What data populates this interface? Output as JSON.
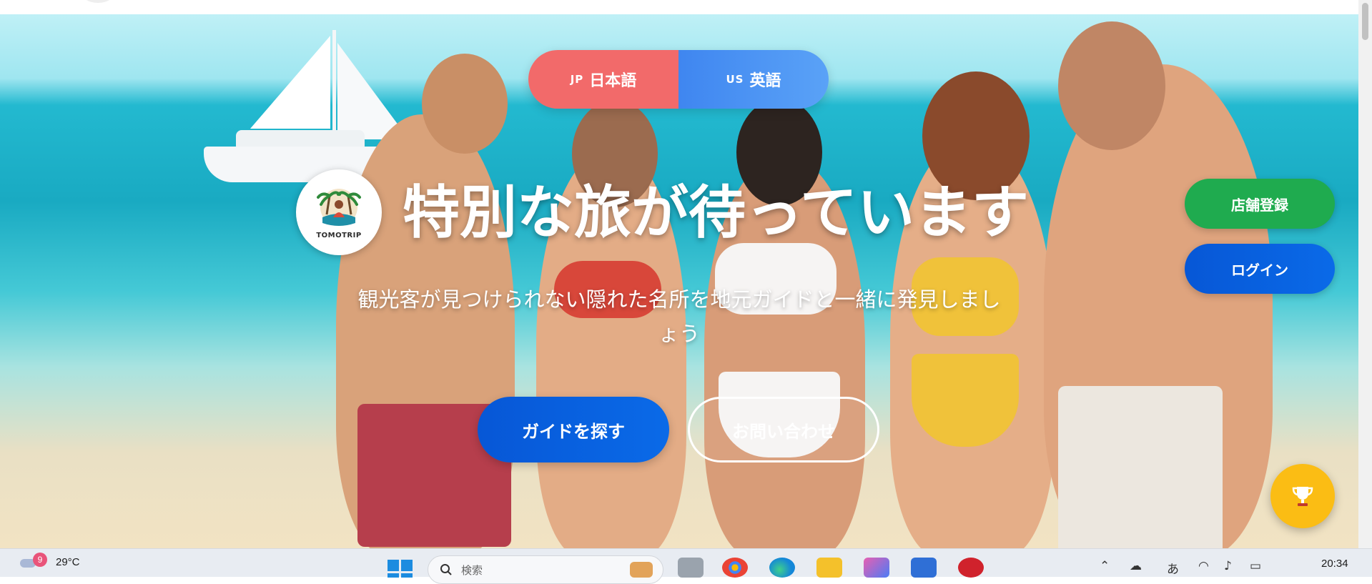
{
  "language_toggle": {
    "jp": {
      "flag": "JP",
      "label": "日本語"
    },
    "us": {
      "flag": "US",
      "label": "英語"
    }
  },
  "logo": {
    "text": "TOMOTRIP"
  },
  "hero": {
    "title": "特別な旅が待っています",
    "subtitle": "観光客が見つけられない隠れた名所を地元ガイドと一緒に発見しましょう"
  },
  "cta": {
    "find_guide": "ガイドを探す",
    "contact": "お問い合わせ"
  },
  "side_actions": {
    "store_register": "店舗登録",
    "login": "ログイン"
  },
  "floating": {
    "icon": "trophy-icon"
  },
  "colors": {
    "jp_button": "#f26a6a",
    "us_button": "#4a93f3",
    "primary_blue": "#0757d6",
    "green": "#1fab4f",
    "trophy_fab": "#fbbd14"
  },
  "taskbar": {
    "weather_badge": "9",
    "temperature": "29°C",
    "search_placeholder": "検索",
    "ime_indicator": "あ",
    "clock": "20:34"
  }
}
